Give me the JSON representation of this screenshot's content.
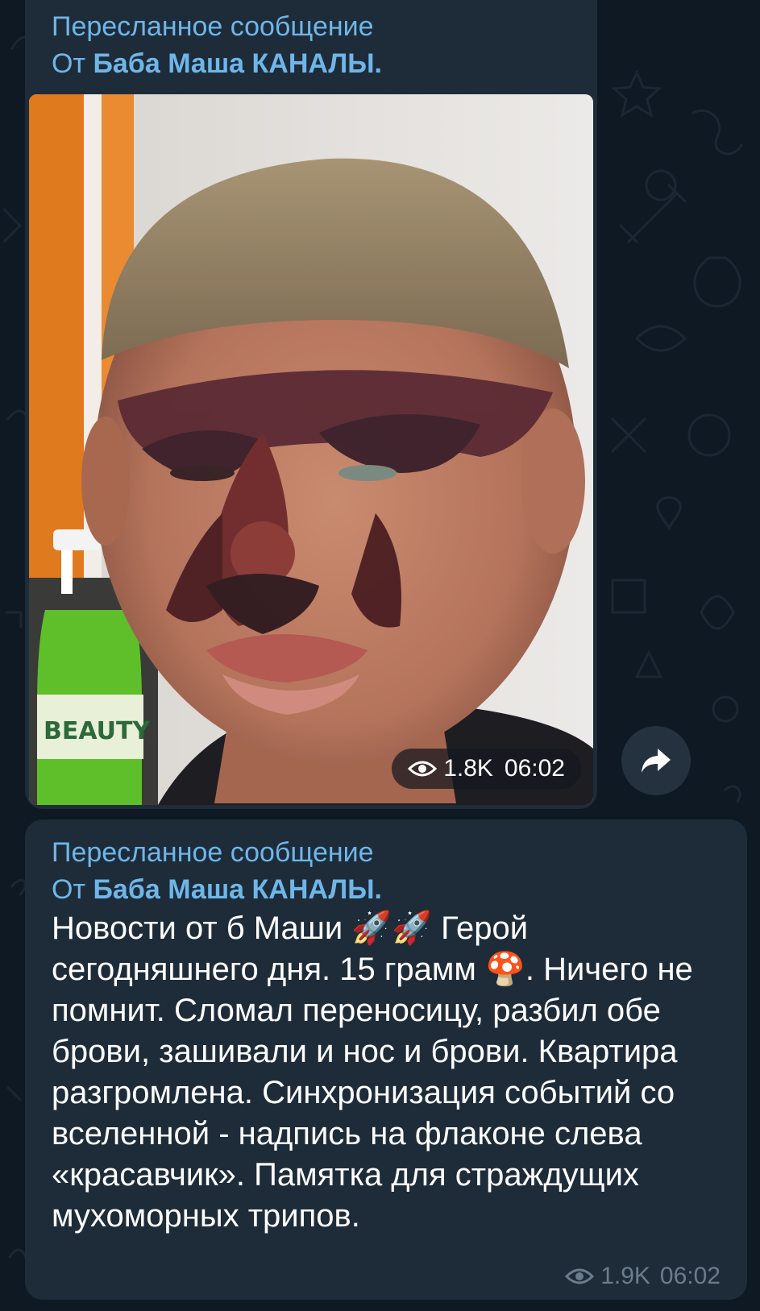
{
  "messages": [
    {
      "forwarded_label": "Пересланное сообщение",
      "from_prefix": "От",
      "from_name": "Баба Маша КАНАЛЫ.",
      "photo": {
        "label_on_bottle": "BEAUTY"
      },
      "views": "1.8K",
      "time": "06:02"
    },
    {
      "forwarded_label": "Пересланное сообщение",
      "from_prefix": "От",
      "from_name": "Баба Маша КАНАЛЫ.",
      "text": {
        "part1": "Новости от б Маши ",
        "emoji_rocket": "🚀🚀",
        "part2": " Герой сегодняшнего дня. 15 грамм ",
        "emoji_mushroom": "🍄",
        "part3": ". Ничего не помнит. Сломал переносицу,  разбил обе брови, зашивали и нос и брови. Квартира разгромлена. Синхронизация событий со вселенной - надпись на флаконе слева «красавчик». Памятка для страждущих мухоморных трипов."
      },
      "views": "1.9K",
      "time": "06:02"
    }
  ],
  "icons": {
    "views": "eye-icon",
    "share": "share-arrow-icon"
  },
  "colors": {
    "background": "#0f1923",
    "bubble": "#1e2c3a",
    "link": "#6fb6e8",
    "meta": "#6b7c8c"
  }
}
